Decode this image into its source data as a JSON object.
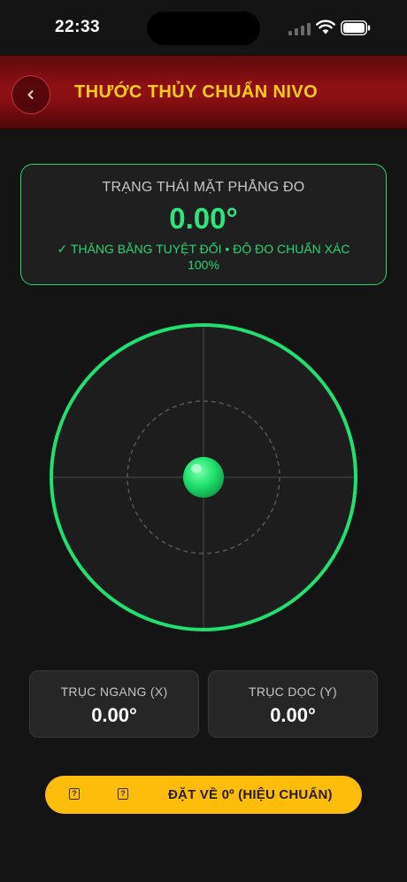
{
  "status_bar": {
    "time": "22:33"
  },
  "header": {
    "title": "THƯỚC THỦY CHUẨN NIVO",
    "back_icon": "chevron-left-icon"
  },
  "status_card": {
    "label": "TRẠNG THÁI MẶT PHẲNG ĐO",
    "value": "0.00°",
    "message": "✓ THĂNG BẰNG TUYỆT ĐỐI • ĐỘ ĐO CHUẨN XÁC 100%"
  },
  "level": {
    "bubble_x": 0,
    "bubble_y": 0,
    "ring_color": "#20e070",
    "bubble_color": "#22e36e"
  },
  "axes": {
    "x": {
      "label": "TRỤC NGANG (X)",
      "value": "0.00°"
    },
    "y": {
      "label": "TRỤC DỌC (Y)",
      "value": "0.00°"
    }
  },
  "reset_button": {
    "label": "ĐẶT VỀ 0º (HIỆU CHUẨN)",
    "icon_1": "?",
    "icon_2": "?",
    "color": "#ffbd0b"
  },
  "colors": {
    "accent_gold": "#ffcc1a",
    "accent_green": "#2ee57b",
    "header_red": "#8e1014",
    "background": "#141414"
  }
}
